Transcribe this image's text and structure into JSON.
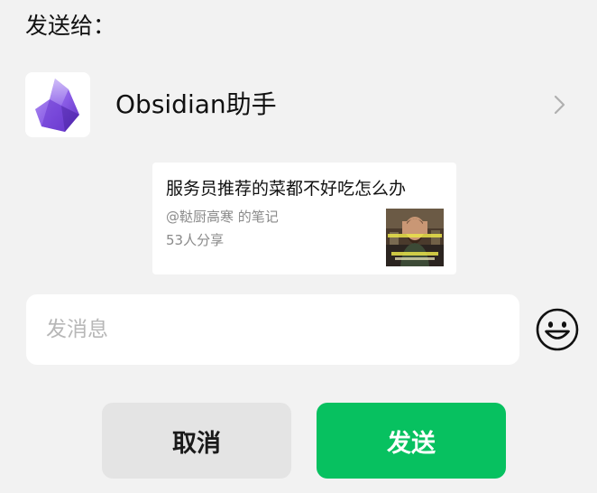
{
  "dialog": {
    "send_to_label": "发送给："
  },
  "recipient": {
    "name": "Obsidian助手",
    "avatar_icon": "obsidian-crystal-icon",
    "accent_color": "#7c4ddb"
  },
  "share_card": {
    "title": "服务员推荐的菜都不好吃怎么办",
    "author": "@鞑厨高寒 的笔记",
    "shares": "53人分享"
  },
  "message": {
    "placeholder": "发消息",
    "value": ""
  },
  "buttons": {
    "cancel_label": "取消",
    "send_label": "发送",
    "send_color": "#07c160"
  },
  "icons": {
    "emoji": "smiley-face-icon",
    "chevron": "chevron-right-icon"
  }
}
